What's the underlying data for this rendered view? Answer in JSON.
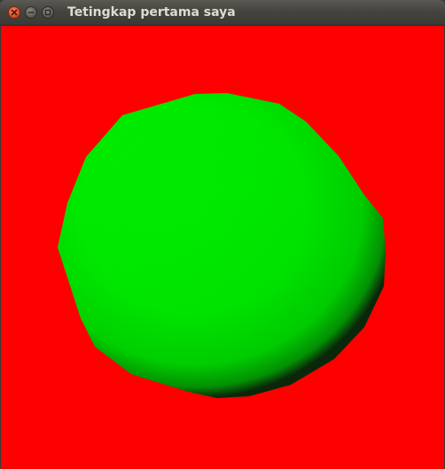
{
  "window": {
    "title": "Tetingkap pertama saya"
  },
  "titlebar_buttons": {
    "close": "close-icon",
    "minimize": "minimize-icon",
    "maximize": "maximize-icon"
  },
  "scene": {
    "background_color": "#ff0000",
    "sphere_color": "#00ff00",
    "sphere_shade_color": "#0b2a0b"
  }
}
